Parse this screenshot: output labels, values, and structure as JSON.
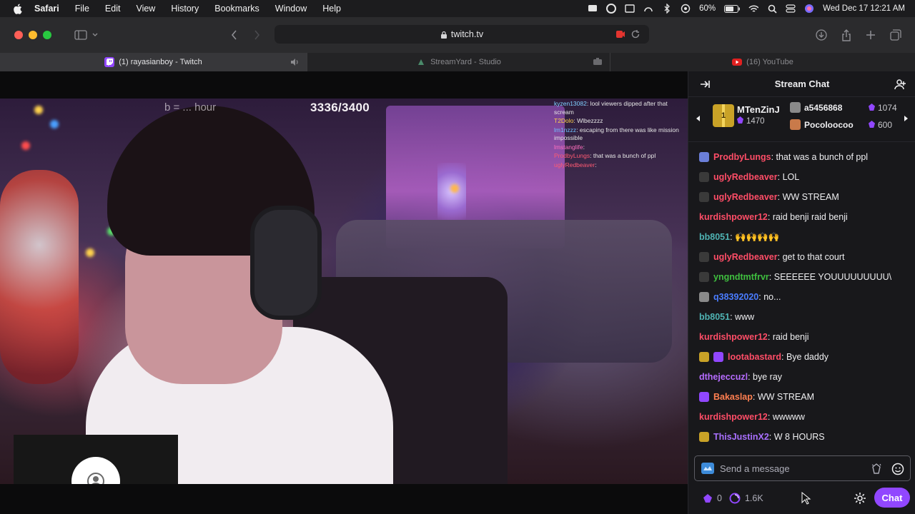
{
  "menubar": {
    "app": "Safari",
    "items": [
      "File",
      "Edit",
      "View",
      "History",
      "Bookmarks",
      "Window",
      "Help"
    ],
    "battery": "60%",
    "datetime": "Wed Dec 17  12:21 AM"
  },
  "toolbar": {
    "url": "twitch.tv"
  },
  "tabs": [
    {
      "label": "(1) rayasianboy - Twitch",
      "active": true
    },
    {
      "label": "StreamYard - Studio",
      "active": false
    },
    {
      "label": "(16) YouTube",
      "active": false
    }
  ],
  "video": {
    "goal_text": "b = ... hour",
    "goal_count": "3336/3400",
    "overlay_chat": [
      {
        "user": "kyzen13082",
        "text": "lool viewers dipped after that scream"
      },
      {
        "user": "T2Dolo",
        "text": "Wlbezzzz"
      },
      {
        "user": "lm1nzzz",
        "text": "escaping from there was like mission impossible"
      },
      {
        "user": "lmstanglife",
        "text": ""
      },
      {
        "user": "ProdbyLungs",
        "text": "that was a bunch of ppl"
      },
      {
        "user": "uglyRedbeaver",
        "text": ""
      }
    ]
  },
  "chat": {
    "title": "Stream Chat",
    "leaderboard": {
      "top": {
        "name": "MTenZinJ",
        "score": "1470",
        "rank": "1"
      },
      "others": [
        {
          "name": "a5456868",
          "score": "1074"
        },
        {
          "name": "Pocoloocoo",
          "score": "600"
        }
      ]
    },
    "messages": [
      {
        "user": "ProdbyLungs",
        "text": ": that was a bunch of ppl",
        "color": "#ff4d67",
        "badge": "#6b7fd9"
      },
      {
        "user": "uglyRedbeaver",
        "text": ": LOL",
        "color": "#ff4d67",
        "badge": "#3a3a3a"
      },
      {
        "user": "uglyRedbeaver",
        "text": ": WW STREAM",
        "color": "#ff4d67",
        "badge": "#3a3a3a"
      },
      {
        "user": "kurdishpower12",
        "text": ": raid benji raid benji",
        "color": "#ff4d67",
        "badge": ""
      },
      {
        "user": "bb8051",
        "text": ": 🙌🙌🙌🙌",
        "color": "#4fb3b3",
        "badge": ""
      },
      {
        "user": "uglyRedbeaver",
        "text": ": get to that court",
        "color": "#ff4d67",
        "badge": "#3a3a3a"
      },
      {
        "user": "yngndtmtfrvr",
        "text": ": SEEEEEE YOUUUUUUUUU\\",
        "color": "#3fbf3f",
        "badge": "#3a3a3a"
      },
      {
        "user": "q38392020",
        "text": ": no...",
        "color": "#4a7cff",
        "badge": "#8a8a8a"
      },
      {
        "user": "bb8051",
        "text": ": www",
        "color": "#4fb3b3",
        "badge": ""
      },
      {
        "user": "kurdishpower12",
        "text": ": raid benji",
        "color": "#ff4d67",
        "badge": ""
      },
      {
        "user": "lootabastard",
        "text": ": Bye daddy",
        "color": "#ff4d67",
        "badge": "#c9a227"
      },
      {
        "user": "dthejeccuzl",
        "text": ": bye ray",
        "color": "#b66cff",
        "badge": ""
      },
      {
        "user": "Bakaslap",
        "text": ": WW STREAM",
        "color": "#ff7f50",
        "badge": "#9147ff"
      },
      {
        "user": "kurdishpower12",
        "text": ": wwwww",
        "color": "#ff4d67",
        "badge": ""
      },
      {
        "user": "ThisJustinX2",
        "text": ": W 8 HOURS",
        "color": "#a970ff",
        "badge": "#c9a227"
      }
    ],
    "input_placeholder": "Send a message",
    "footer": {
      "bits": "0",
      "points": "1.6K",
      "chat_button": "Chat"
    }
  }
}
